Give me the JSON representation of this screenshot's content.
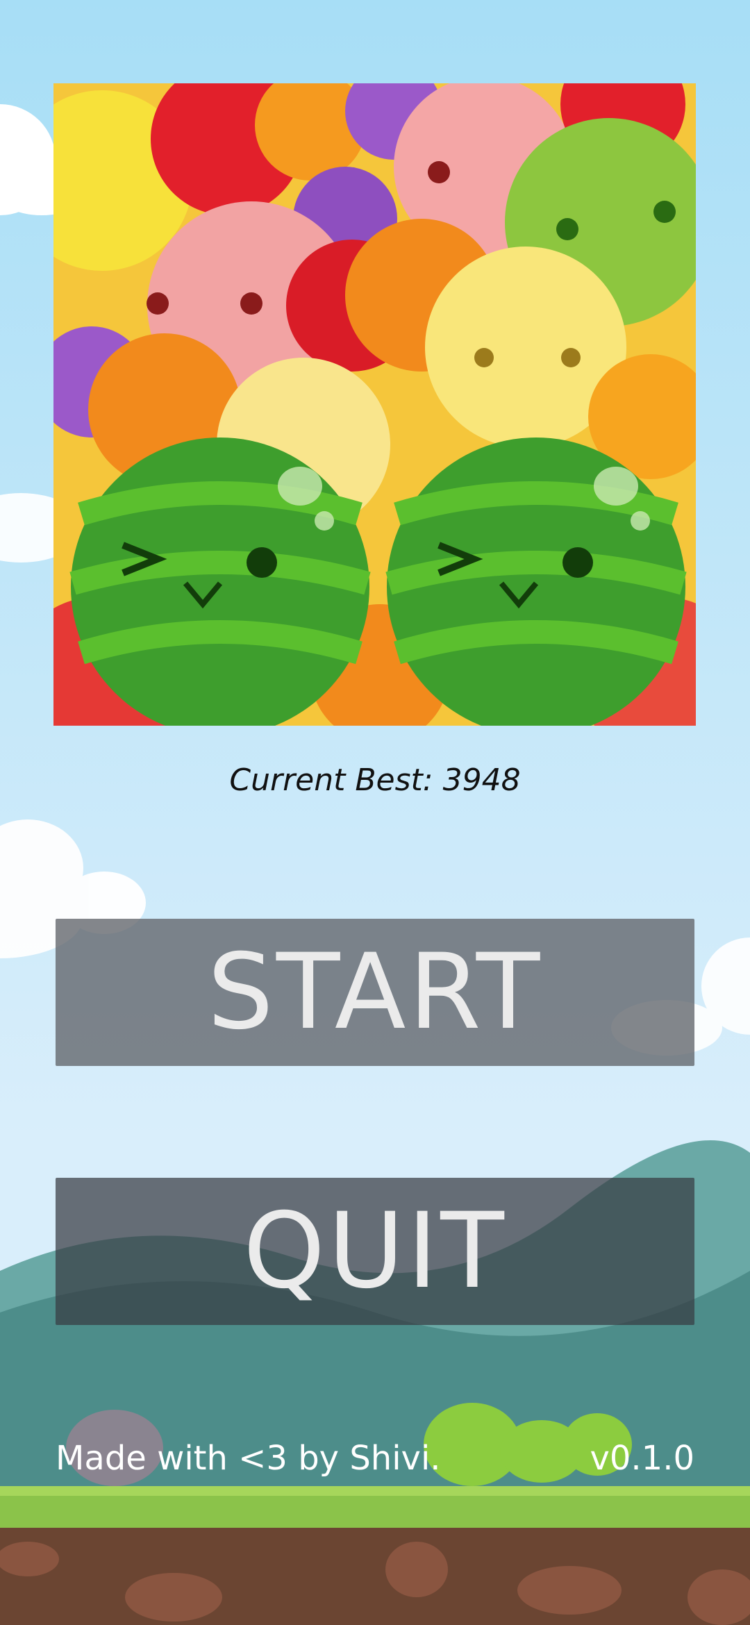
{
  "screen": "main-menu",
  "hero": {
    "icon": "fruit-collage-icon"
  },
  "best": {
    "text": "Current Best: 3948"
  },
  "buttons": {
    "start_label": "START",
    "quit_label": "QUIT"
  },
  "footer": {
    "credit": "Made with <3 by Shivi.",
    "version": "v0.1.0"
  },
  "colors": {
    "sky_top": "#a7def6",
    "sky_bottom": "#d9eefb",
    "hills": "#5a9b9a",
    "grass": "#8bc34a",
    "dirt": "#6b4532",
    "watermelon": "#3e9e2d"
  }
}
